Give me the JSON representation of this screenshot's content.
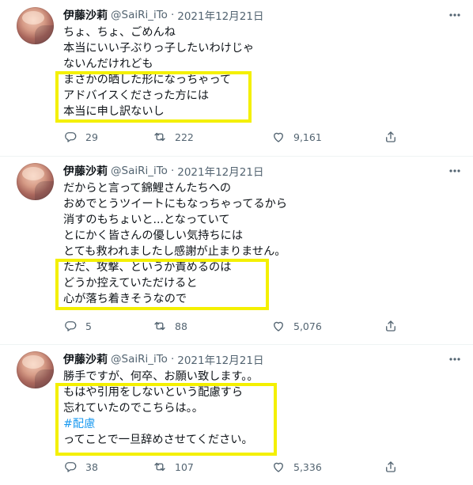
{
  "tweets": [
    {
      "user": {
        "name": "伊藤沙莉",
        "handle": "@SaiRi_iTo",
        "date": "2021年12月21日",
        "separator": "·"
      },
      "lines": [
        {
          "text": "ちょ、ちょ、ごめんね"
        },
        {
          "text": "本当にいい子ぶりっ子したいわけじゃ"
        },
        {
          "text": "ないんだけれども"
        },
        {
          "text": "まさかの晒した形になっちゃって"
        },
        {
          "text": "アドバイスくださった方には"
        },
        {
          "text": "本当に申し訳ないし"
        }
      ],
      "stats": {
        "replies": "29",
        "retweets": "222",
        "likes": "9,161"
      }
    },
    {
      "user": {
        "name": "伊藤沙莉",
        "handle": "@SaiRi_iTo",
        "date": "2021年12月21日",
        "separator": "·"
      },
      "lines": [
        {
          "text": "だからと言って錦鯉さんたちへの"
        },
        {
          "text": "おめでとうツイートにもなっちゃってるから"
        },
        {
          "text": "消すのもちょいと...となっていて"
        },
        {
          "text": "とにかく皆さんの優しい気持ちには"
        },
        {
          "text": "とても救われましたし感謝が止まりません。"
        },
        {
          "text": "ただ、攻撃、というか責めるのは"
        },
        {
          "text": "どうか控えていただけると"
        },
        {
          "text": "心が落ち着きそうなので"
        }
      ],
      "stats": {
        "replies": "5",
        "retweets": "88",
        "likes": "5,076"
      }
    },
    {
      "user": {
        "name": "伊藤沙莉",
        "handle": "@SaiRi_iTo",
        "date": "2021年12月21日",
        "separator": "·"
      },
      "lines": [
        {
          "text": "勝手ですが、何卒、お願い致します。。"
        },
        {
          "text": "もはや引用をしないという配慮すら"
        },
        {
          "text": "忘れていたのでこちらは。。"
        },
        {
          "text": "#配慮",
          "hashtag": true
        },
        {
          "text": "ってことで一旦辞めさせてください。"
        }
      ],
      "stats": {
        "replies": "38",
        "retweets": "107",
        "likes": "5,336"
      }
    }
  ],
  "colors": {
    "highlight": "#f4f000",
    "hashtag": "#1d9bf0",
    "secondary_text": "#536471"
  },
  "icons": {
    "reply": "reply-icon",
    "retweet": "retweet-icon",
    "like": "heart-icon",
    "share": "share-icon",
    "more": "more-icon"
  }
}
